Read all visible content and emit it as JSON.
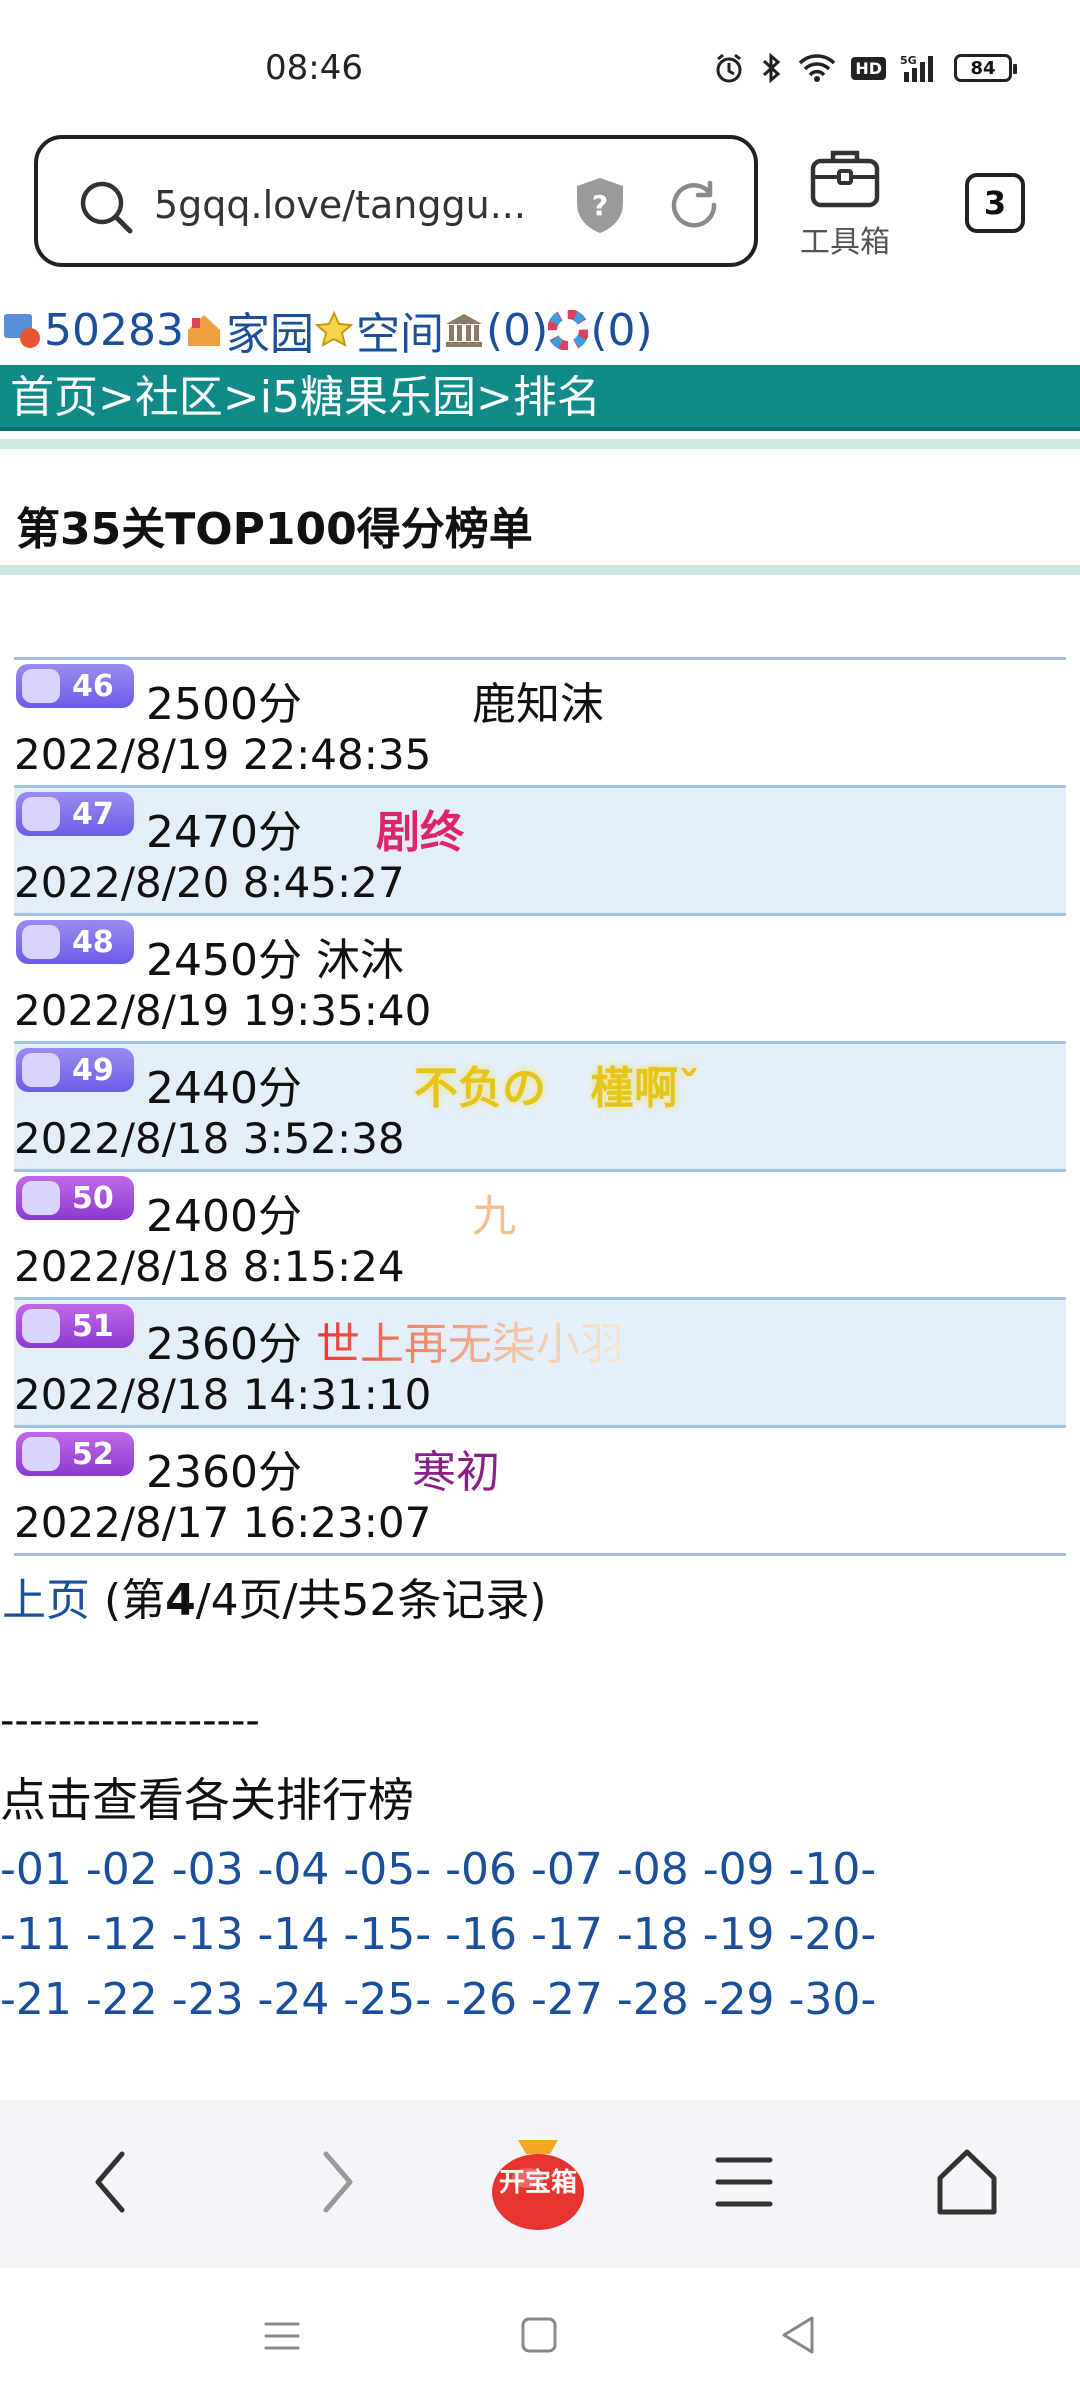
{
  "status": {
    "time": "08:46",
    "battery": "84",
    "hd": "HD"
  },
  "browser": {
    "url": "5gqq.love/tanggu...",
    "toolbox_label": "工具箱",
    "tab_count": "3"
  },
  "userbar": {
    "id": "50283",
    "home": "家园",
    "space": "空间",
    "count1": "(0)",
    "count2": "(0)"
  },
  "breadcrumb": "首页>社区>i5糖果乐园>排名",
  "board_title": "第35关TOP100得分榜单",
  "rankings": [
    {
      "rank": "46",
      "score": "2500分",
      "name": "鹿知沫",
      "time": "2022/8/19 22:48:35"
    },
    {
      "rank": "47",
      "score": "2470分",
      "name": "剧终",
      "time": "2022/8/20 8:45:27"
    },
    {
      "rank": "48",
      "score": "2450分",
      "name": "沐沐",
      "time": "2022/8/19 19:35:40"
    },
    {
      "rank": "49",
      "score": "2440分",
      "name": "不负の　槿啊ˇ",
      "time": "2022/8/18 3:52:38"
    },
    {
      "rank": "50",
      "score": "2400分",
      "name": "九",
      "time": "2022/8/18 8:15:24"
    },
    {
      "rank": "51",
      "score": "2360分",
      "name": "世上再无柒小羽",
      "time": "2022/8/18 14:31:10"
    },
    {
      "rank": "52",
      "score": "2360分",
      "name": "寒初",
      "time": "2022/8/17 16:23:07"
    }
  ],
  "pager": {
    "prev": "上页",
    "info_pre": " (第",
    "current": "4",
    "info_post": "/4页/共52条记录)"
  },
  "dashes": "------------------",
  "levels_title": "点击查看各关排行榜",
  "level_rows": [
    "-01 -02 -03 -04 -05- -06 -07 -08 -09 -10-",
    "-11 -12 -13 -14 -15- -16 -17 -18 -19 -20-",
    "-21 -22 -23 -24 -25- -26 -27 -28 -29 -30-"
  ],
  "bottom_nav": {
    "treasure_label": "开宝箱"
  },
  "colors": {
    "link": "#1a4f9c",
    "crumb_bg": "#118a8a",
    "alt_row": "#e3eef8",
    "name_47": "#e0246a",
    "name_49": "#e6c51a",
    "name_50": "#f3c08c",
    "name_52": "#8a1f8a"
  }
}
